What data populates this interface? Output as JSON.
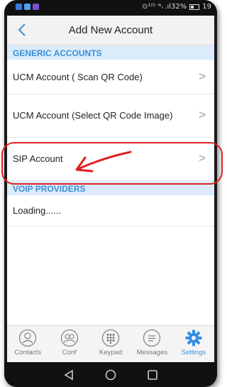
{
  "status_bar": {
    "indicators": "⊙¹⁽ˡ⁾ ʷₗ .ıl32%",
    "time": "19"
  },
  "header": {
    "title": "Add New Account",
    "back_icon": "chevron-left-icon"
  },
  "sections": {
    "generic": "GENERIC ACCOUNTS",
    "voip": "VOIP PROVIDERS"
  },
  "generic_accounts": [
    {
      "label": "UCM Account ( Scan QR Code)"
    },
    {
      "label": "UCM Account (Select QR Code Image)"
    },
    {
      "label": "SIP Account"
    }
  ],
  "voip_providers": {
    "loading_text": "Loading......"
  },
  "chevron_glyph": ">",
  "tabs": [
    {
      "label": "Contacts",
      "icon": "person-icon",
      "active": false
    },
    {
      "label": "Conf",
      "icon": "group-icon",
      "active": false
    },
    {
      "label": "Keypad",
      "icon": "keypad-icon",
      "active": false
    },
    {
      "label": "Messages",
      "icon": "message-icon",
      "active": false
    },
    {
      "label": "Settings",
      "icon": "gear-icon",
      "active": true
    }
  ],
  "colors": {
    "accent": "#3b8fd6",
    "section_bg": "#dcebfa",
    "annotation": "#e0201f"
  }
}
